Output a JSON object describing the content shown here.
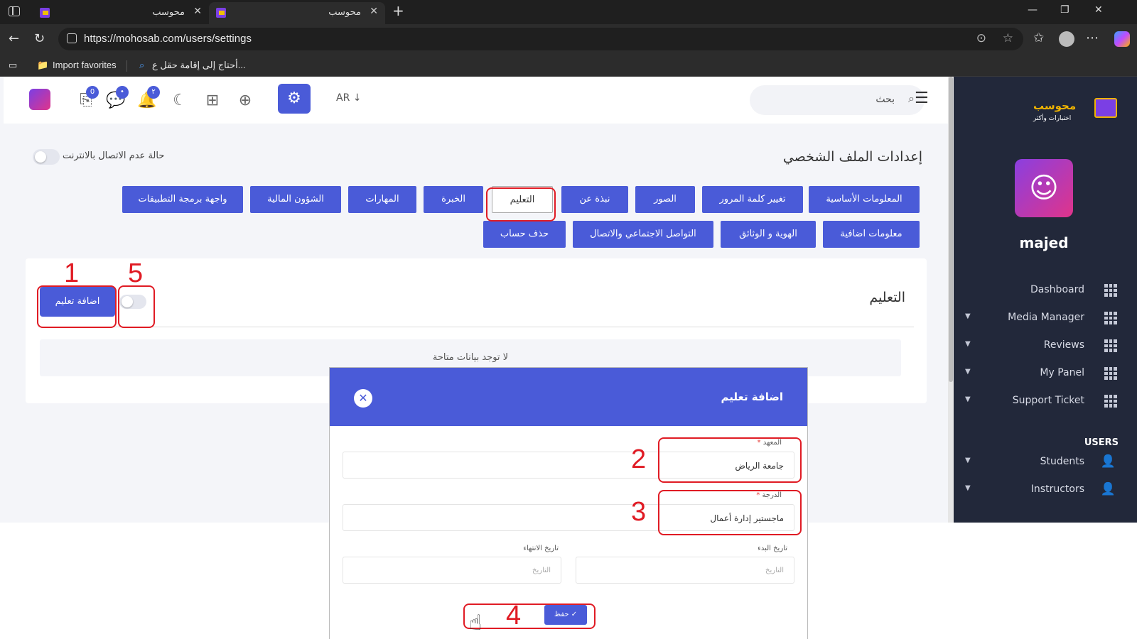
{
  "browser": {
    "tabs": [
      {
        "title": "محوسب"
      },
      {
        "title": "محوسب"
      }
    ],
    "url": "https://mohosab.com/users/settings",
    "favorites": [
      {
        "label": "Import favorites"
      },
      {
        "label": "أحتاج إلى إقامة حقل ع..."
      }
    ]
  },
  "header": {
    "badges": {
      "cart": "0",
      "messages": "•",
      "notifications": "٢"
    },
    "language": "AR",
    "search_placeholder": "بحث"
  },
  "page": {
    "title": "إعدادات الملف الشخصي",
    "offline_label": "حالة عدم الاتصال بالانترنت",
    "tabs_row1": [
      "المعلومات الأساسية",
      "تغيير كلمة المرور",
      "الصور",
      "نبذة عن",
      "التعليم",
      "الخبرة",
      "المهارات",
      "الشؤون المالية",
      "واجهة برمجة التطبيقات"
    ],
    "tabs_row2": [
      "معلومات اضافية",
      "الهوية و الوثائق",
      "التواصل الاجتماعي والاتصال",
      "حذف حساب"
    ],
    "active_tab": "التعليم"
  },
  "education": {
    "title": "التعليم",
    "add_button": "اضافة تعليم",
    "empty_text": "لا توجد بيانات متاحة"
  },
  "sidebar": {
    "logo_text": "محوسب",
    "logo_sub": "اختبارات وأكثر",
    "username": "majed",
    "items": [
      {
        "label": "Dashboard"
      },
      {
        "label": "Media Manager"
      },
      {
        "label": "Reviews"
      },
      {
        "label": "My Panel"
      },
      {
        "label": "Support Ticket"
      }
    ],
    "section_users": "USERS",
    "user_items": [
      {
        "label": "Students"
      },
      {
        "label": "Instructors"
      }
    ]
  },
  "modal": {
    "title": "اضافة تعليم",
    "institute_label": "المعهد",
    "institute_value": "جامعة الرياض",
    "degree_label": "الدرجة",
    "degree_value": "ماجستير إدارة أعمال",
    "start_label": "تاريخ البدء",
    "end_label": "تاريخ الانتهاء",
    "date_placeholder": "التاريخ",
    "save_label": "حفظ ✓"
  },
  "annotations": [
    "1",
    "2",
    "3",
    "4",
    "5"
  ],
  "colors": {
    "primary": "#4a5bd8",
    "sidebar": "#22283a",
    "annotation": "#e01b24"
  }
}
